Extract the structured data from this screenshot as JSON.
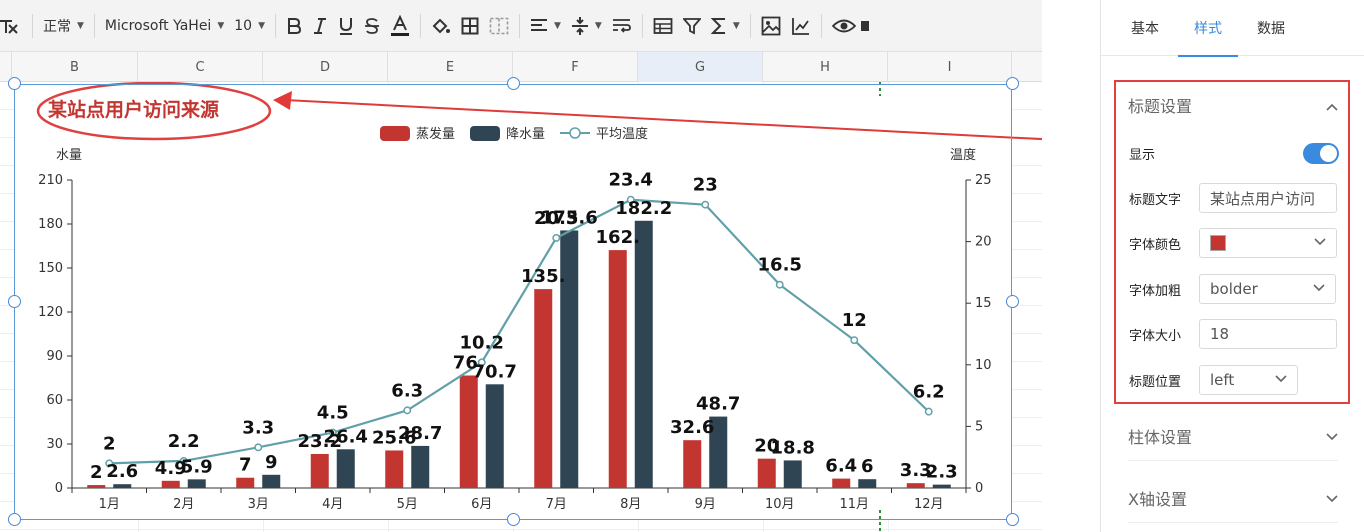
{
  "toolbar": {
    "style": "正常",
    "font_family": "Microsoft YaHei",
    "font_size": "10",
    "icons": [
      "clear-format-icon",
      "bold-icon",
      "italic-icon",
      "underline-icon",
      "strikethrough-icon",
      "font-color-icon",
      "fill-color-icon",
      "border-icon",
      "merge-cells-icon",
      "align-icon",
      "vertical-align-icon",
      "wrap-text-icon",
      "table-icon",
      "filter-icon",
      "sum-icon",
      "image-icon",
      "chart-icon",
      "preview-icon"
    ]
  },
  "columns": [
    "B",
    "C",
    "D",
    "E",
    "F",
    "G",
    "H",
    "I"
  ],
  "selected_column": "G",
  "panel": {
    "tabs": [
      "基本",
      "样式",
      "数据"
    ],
    "active_tab": "样式",
    "title_section": {
      "header": "标题设置",
      "show_label": "显示",
      "show_value": true,
      "text_label": "标题文字",
      "text_value": "某站点用户访问",
      "color_label": "字体颜色",
      "color_value": "#c23531",
      "weight_label": "字体加粗",
      "weight_value": "bolder",
      "size_label": "字体大小",
      "size_value": "18",
      "position_label": "标题位置",
      "position_value": "left"
    },
    "bar_section": "柱体设置",
    "xaxis_section": "X轴设置"
  },
  "chart_data": {
    "type": "bar",
    "title": "某站点用户访问来源",
    "title_color": "#c23531",
    "categories": [
      "1月",
      "2月",
      "3月",
      "4月",
      "5月",
      "6月",
      "7月",
      "8月",
      "9月",
      "10月",
      "11月",
      "12月"
    ],
    "series": [
      {
        "name": "蒸发量",
        "type": "bar",
        "color": "#c23531",
        "axis": "left",
        "values": [
          2,
          4.9,
          7,
          23.2,
          25.6,
          76.7,
          135.6,
          162.2,
          32.6,
          20,
          6.4,
          3.3
        ],
        "labels": [
          "2",
          "4.9",
          "7",
          "23.2",
          "25.6",
          "76.",
          "135.",
          "162.",
          "32.6",
          "20",
          "6.4",
          "3.3"
        ]
      },
      {
        "name": "降水量",
        "type": "bar",
        "color": "#2f4554",
        "axis": "left",
        "values": [
          2.6,
          5.9,
          9,
          26.4,
          28.7,
          70.7,
          175.6,
          182.2,
          48.7,
          18.8,
          6,
          2.3
        ],
        "labels": [
          "2.6",
          "5.9",
          "9",
          "26.4",
          "28.7",
          "70.7",
          "175.6",
          "182.2",
          "48.7",
          "18.8",
          "6",
          "2.3"
        ]
      },
      {
        "name": "平均温度",
        "type": "line",
        "color": "#61a0a8",
        "axis": "right",
        "values": [
          2,
          2.2,
          3.3,
          4.5,
          6.3,
          10.2,
          20.3,
          23.4,
          23,
          16.5,
          12,
          6.2
        ],
        "labels": [
          "2",
          "2.2",
          "3.3",
          "4.5",
          "6.3",
          "10.2",
          "20.3",
          "23.4",
          "23",
          "16.5",
          "12",
          "6.2"
        ]
      }
    ],
    "ylabel_left": "水量",
    "ylabel_right": "温度",
    "ylim_left": [
      0,
      210
    ],
    "ylim_right": [
      0,
      25
    ],
    "yticks_left": [
      0,
      30,
      60,
      90,
      120,
      150,
      180,
      210
    ],
    "yticks_right": [
      0,
      5,
      10,
      15,
      20,
      25
    ],
    "legend_position": "top-center",
    "grid": false
  }
}
